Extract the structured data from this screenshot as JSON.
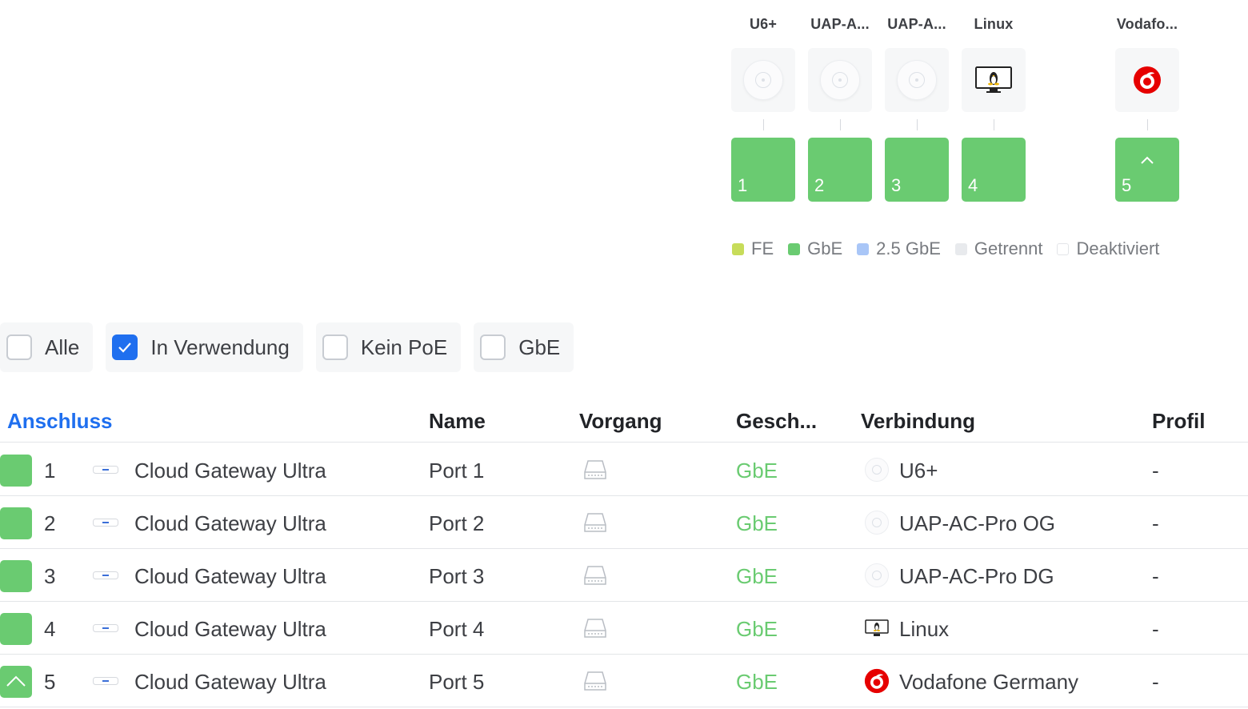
{
  "topology": {
    "devices": [
      {
        "name": "U6+",
        "icon": "access-point-icon",
        "port": "1"
      },
      {
        "name": "UAP-A...",
        "icon": "access-point-icon",
        "port": "2"
      },
      {
        "name": "UAP-A...",
        "icon": "access-point-icon",
        "port": "3"
      },
      {
        "name": "Linux",
        "icon": "linux-monitor-icon",
        "port": "4"
      },
      {
        "name": "Vodafo...",
        "icon": "vodafone-logo-icon",
        "port": "5"
      }
    ],
    "legend": [
      {
        "label": "FE",
        "color": "#c7dc5a"
      },
      {
        "label": "GbE",
        "color": "#6acb71"
      },
      {
        "label": "2.5 GbE",
        "color": "#a9c6f7"
      },
      {
        "label": "Getrennt",
        "color": "#e8eaed"
      },
      {
        "label": "Deaktiviert",
        "color": "#ffffff"
      }
    ]
  },
  "filters": [
    {
      "label": "Alle",
      "checked": false
    },
    {
      "label": "In Verwendung",
      "checked": true
    },
    {
      "label": "Kein PoE",
      "checked": false
    },
    {
      "label": "GbE",
      "checked": false
    }
  ],
  "table": {
    "headers": {
      "anschluss": "Anschluss",
      "name": "Name",
      "vorgang": "Vorgang",
      "geschwindigkeit": "Gesch...",
      "verbindung": "Verbindung",
      "profil": "Profil"
    },
    "rows": [
      {
        "port": "1",
        "device": "Cloud Gateway Ultra",
        "name": "Port 1",
        "speed": "GbE",
        "connection": "U6+",
        "profile": "-"
      },
      {
        "port": "2",
        "device": "Cloud Gateway Ultra",
        "name": "Port 2",
        "speed": "GbE",
        "connection": "UAP-AC-Pro OG",
        "profile": "-"
      },
      {
        "port": "3",
        "device": "Cloud Gateway Ultra",
        "name": "Port 3",
        "speed": "GbE",
        "connection": "UAP-AC-Pro DG",
        "profile": "-"
      },
      {
        "port": "4",
        "device": "Cloud Gateway Ultra",
        "name": "Port 4",
        "speed": "GbE",
        "connection": "Linux",
        "profile": "-"
      },
      {
        "port": "5",
        "device": "Cloud Gateway Ultra",
        "name": "Port 5",
        "speed": "GbE",
        "connection": "Vodafone Germany",
        "profile": "-"
      }
    ]
  },
  "colors": {
    "port_gbe": "#6acb71",
    "accent": "#1f6fef",
    "vodafone": "#e60000"
  }
}
